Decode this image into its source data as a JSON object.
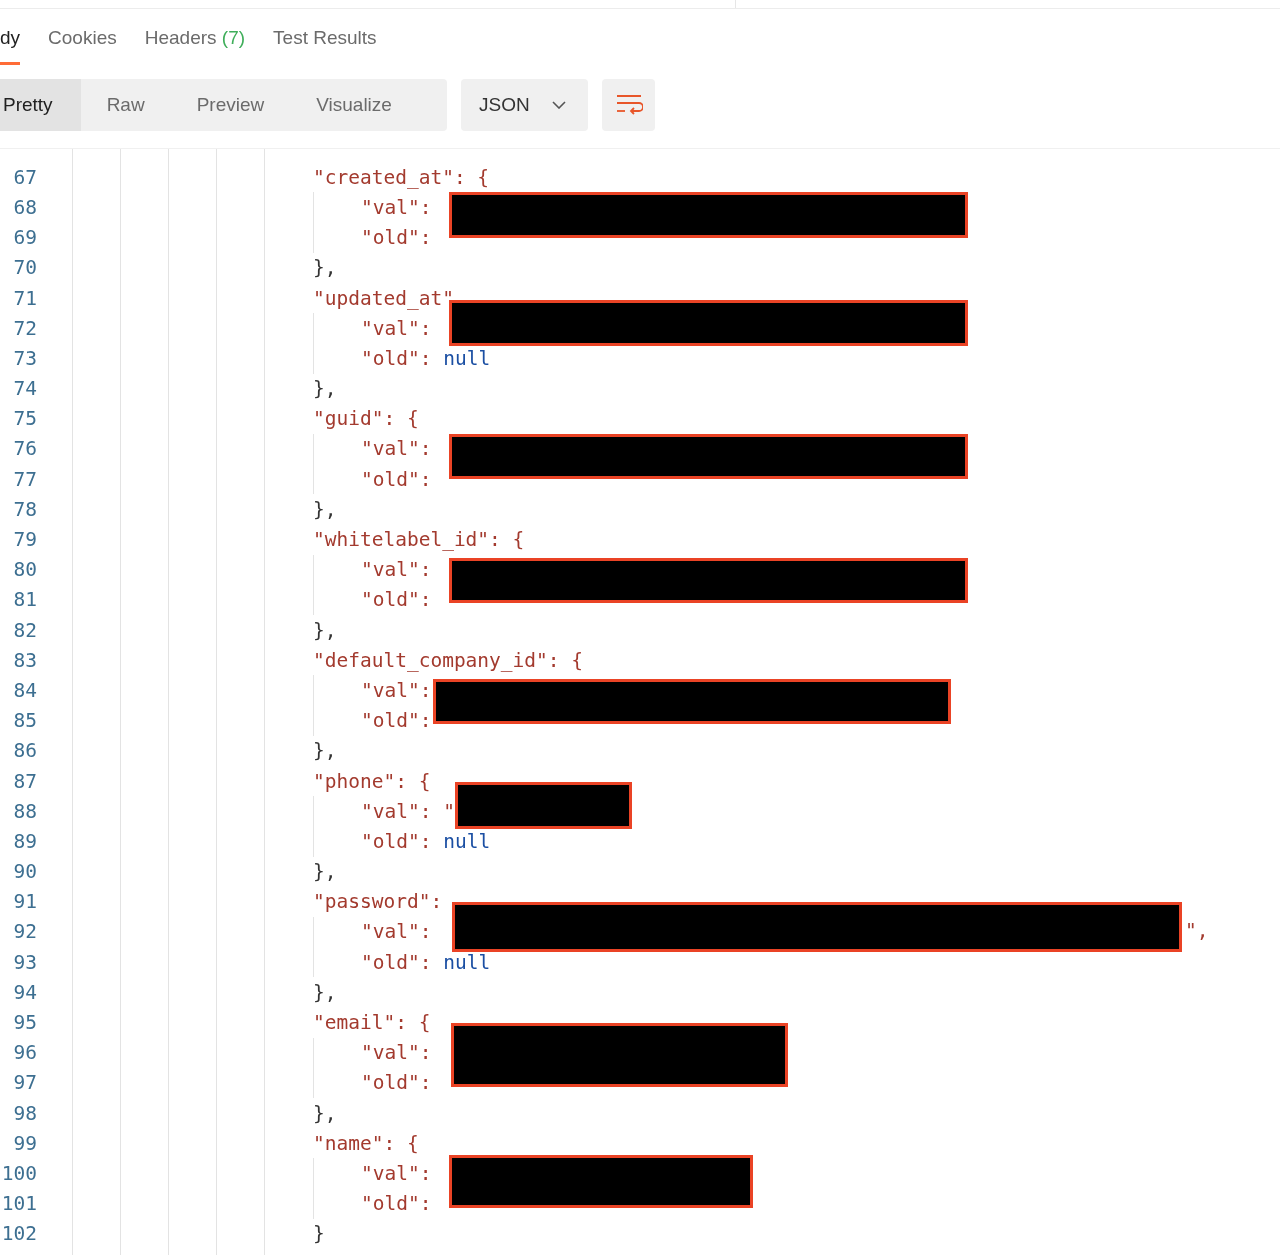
{
  "response_tabs": [
    {
      "label": "dy",
      "selected": true
    },
    {
      "label": "Cookies",
      "selected": false
    },
    {
      "label": "Headers",
      "count": "(7)",
      "selected": false
    },
    {
      "label": "Test Results",
      "selected": false
    }
  ],
  "view_modes": [
    {
      "label": "Pretty",
      "selected": true
    },
    {
      "label": "Raw",
      "selected": false
    },
    {
      "label": "Preview",
      "selected": false
    },
    {
      "label": "Visualize",
      "selected": false
    }
  ],
  "format_dropdown": {
    "value": "JSON"
  },
  "code": {
    "fields": [
      {
        "key": {
          "number": "67",
          "text": "\"created_at\": {"
        },
        "val": {
          "number": "68",
          "text": "\"val\":"
        },
        "old": {
          "number": "69",
          "text": "\"old\":"
        },
        "close": {
          "number": "70",
          "text": "},"
        }
      },
      {
        "key": {
          "number": "71",
          "text": "\"updated_at\""
        },
        "val": {
          "number": "72",
          "text": "\"val\":"
        },
        "old": {
          "number": "73",
          "text": "\"old\":",
          "value": "null"
        },
        "close": {
          "number": "74",
          "text": "},"
        }
      },
      {
        "key": {
          "number": "75",
          "text": "\"guid\": {"
        },
        "val": {
          "number": "76",
          "text": "\"val\":"
        },
        "old": {
          "number": "77",
          "text": "\"old\":"
        },
        "close": {
          "number": "78",
          "text": "},"
        }
      },
      {
        "key": {
          "number": "79",
          "text": "\"whitelabel_id\": {"
        },
        "val": {
          "number": "80",
          "text": "\"val\":"
        },
        "old": {
          "number": "81",
          "text": "\"old\":"
        },
        "close": {
          "number": "82",
          "text": "},"
        }
      },
      {
        "key": {
          "number": "83",
          "text": "\"default_company_id\": {"
        },
        "val": {
          "number": "84",
          "text": "\"val\":"
        },
        "old": {
          "number": "85",
          "text": "\"old\":"
        },
        "close": {
          "number": "86",
          "text": "},"
        }
      },
      {
        "key": {
          "number": "87",
          "text": "\"phone\": {"
        },
        "val": {
          "number": "88",
          "text": "\"val\": \""
        },
        "old": {
          "number": "89",
          "text": "\"old\":",
          "value": "null"
        },
        "close": {
          "number": "90",
          "text": "},"
        }
      },
      {
        "key": {
          "number": "91",
          "text": "\"password\":"
        },
        "val": {
          "number": "92",
          "text": "\"val\":",
          "tail": "\","
        },
        "old": {
          "number": "93",
          "text": "\"old\":",
          "value": "null"
        },
        "close": {
          "number": "94",
          "text": "},"
        }
      },
      {
        "key": {
          "number": "95",
          "text": "\"email\": {"
        },
        "val": {
          "number": "96",
          "text": "\"val\":"
        },
        "old": {
          "number": "97",
          "text": "\"old\":"
        },
        "close": {
          "number": "98",
          "text": "},"
        }
      },
      {
        "key": {
          "number": "99",
          "text": "\"name\": {"
        },
        "val": {
          "number": "100",
          "text": "\"val\":"
        },
        "old": {
          "number": "101",
          "text": "\"old\":"
        },
        "close": {
          "number": "102",
          "text": "}"
        }
      }
    ]
  }
}
